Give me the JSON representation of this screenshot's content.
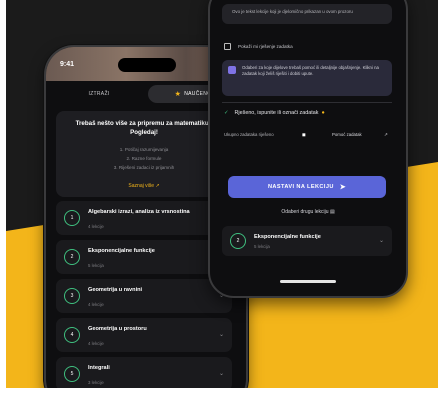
{
  "phone_left": {
    "status": {
      "time": "9:41",
      "icons": "▮▮ ◉ ▬"
    },
    "tabs": [
      {
        "label": "IZTRAŽI",
        "active": false
      },
      {
        "label": "NAUČENO",
        "active": true
      }
    ],
    "card": {
      "title": "Trebaš nešto više za pripremu za matematiku? Pogledaj!",
      "lines": [
        "1. Potičaj razumijevanja",
        "2. Razne formule",
        "3. Riješeni zadaci iz prijamnih"
      ],
      "link": "Saznaj više ↗"
    },
    "items": [
      {
        "num": "1",
        "title": "Algebarski izrazi, analiza iz vrsnostina",
        "sub": "4 lekcije"
      },
      {
        "num": "2",
        "title": "Eksponencijalne funkcije",
        "sub": "5 lekcija"
      },
      {
        "num": "3",
        "title": "Geometrija u ravnini",
        "sub": "4 lekcije"
      },
      {
        "num": "4",
        "title": "Geometrija u prostoru",
        "sub": "4 lekcije"
      },
      {
        "num": "5",
        "title": "Integrali",
        "sub": "3 lekcije"
      }
    ]
  },
  "phone_right": {
    "top_text": "Ovo je tekst lekcije koji je djelomično prikazan u ovom prozoru",
    "checkbox_line": "Pokaži mi rješenje zadatka",
    "info_text": "Odaberi za koje dijelove trebaš pomoć ili detaljnije objašnjenje. Klikni na zadatak koji želiš riješiti i dobiti upute.",
    "solved_text": "Rješeno, ispunite ili označi zadatak",
    "mini_left": "Ukupno zadataka riješeno",
    "mini_right": "Pomoć zadatak",
    "button_label": "NASTAVI NA LEKCIJU",
    "link_text": "Odaberi drugu lekciju",
    "row": {
      "num": "2",
      "title": "Eksponencijalne funkcije",
      "sub": "5 lekcija"
    }
  }
}
